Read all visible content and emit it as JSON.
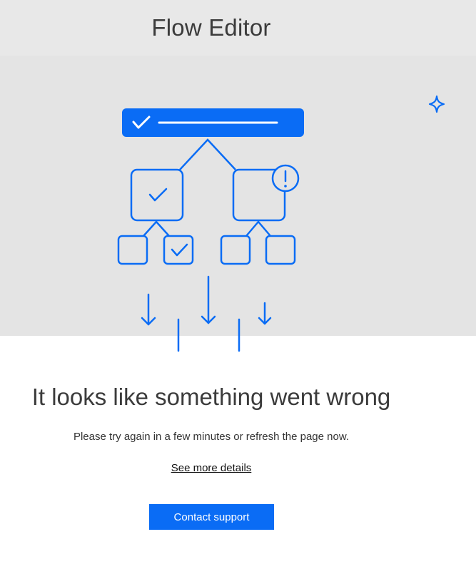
{
  "header": {
    "title": "Flow Editor"
  },
  "error": {
    "title": "It looks like something went wrong",
    "message": "Please try again in a few minutes or refresh the page now.",
    "details_link": "See more details",
    "support_button": "Contact support"
  },
  "illustration": {
    "icons": [
      "check-icon",
      "check-icon",
      "check-icon",
      "exclamation-icon",
      "sparkle-icon",
      "arrow-down-icon"
    ]
  },
  "colors": {
    "accent": "#0a6cf5",
    "header_bg": "#e8e8e8",
    "hero_bg": "#e4e4e4",
    "text": "#3b3b3b"
  }
}
